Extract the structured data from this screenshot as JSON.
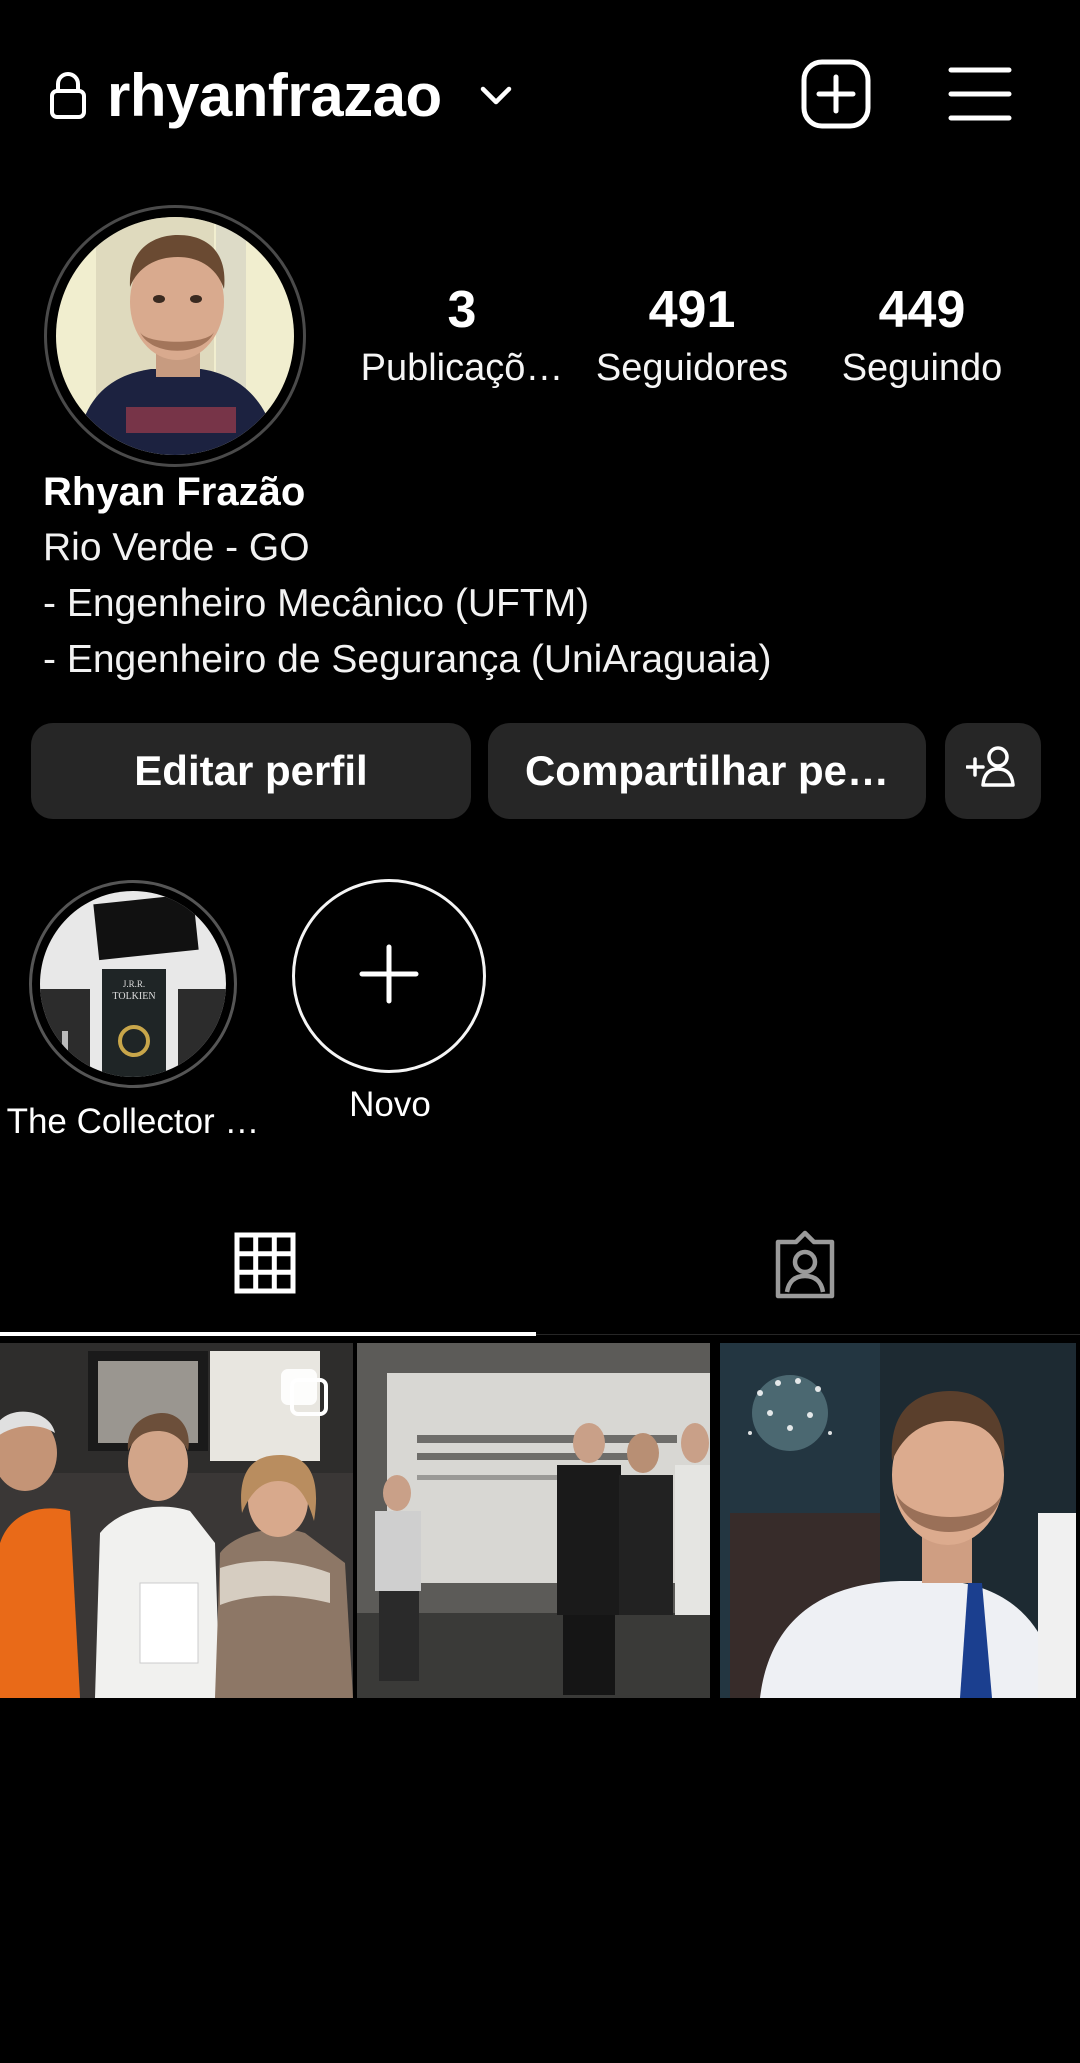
{
  "header": {
    "username": "rhyanfrazao",
    "icons": {
      "lock": "lock-icon",
      "switch_account": "chevron-down-icon",
      "create": "plus-square-icon",
      "menu": "hamburger-menu-icon"
    }
  },
  "profile": {
    "stats": [
      {
        "value": "3",
        "label": "Publicaçõ…"
      },
      {
        "value": "491",
        "label": "Seguidores"
      },
      {
        "value": "449",
        "label": "Seguindo"
      }
    ],
    "name": "Rhyan Frazão",
    "bio_lines": [
      "Rio Verde - GO",
      "- Engenheiro Mecânico (UFTM)",
      "- Engenheiro de Segurança (UniAraguaia)"
    ]
  },
  "actions": {
    "edit_label": "Editar perfil",
    "share_label": "Compartilhar pe…",
    "discover_icon": "add-person-icon"
  },
  "highlights": [
    {
      "label": "The Collector …",
      "book_labels": [
        "J.R.R.",
        "TOLKIEN"
      ]
    },
    {
      "label": "Novo",
      "icon": "plus-icon"
    }
  ],
  "tabs": {
    "selected": "posts",
    "items": [
      "grid-icon",
      "tagged-person-icon"
    ]
  },
  "posts": [
    {
      "type": "carousel",
      "icon": "carousel-icon"
    },
    {
      "type": "image"
    },
    {
      "type": "image"
    }
  ],
  "colors": {
    "background": "#000000",
    "button": "#262626",
    "text": "#ffffff"
  }
}
